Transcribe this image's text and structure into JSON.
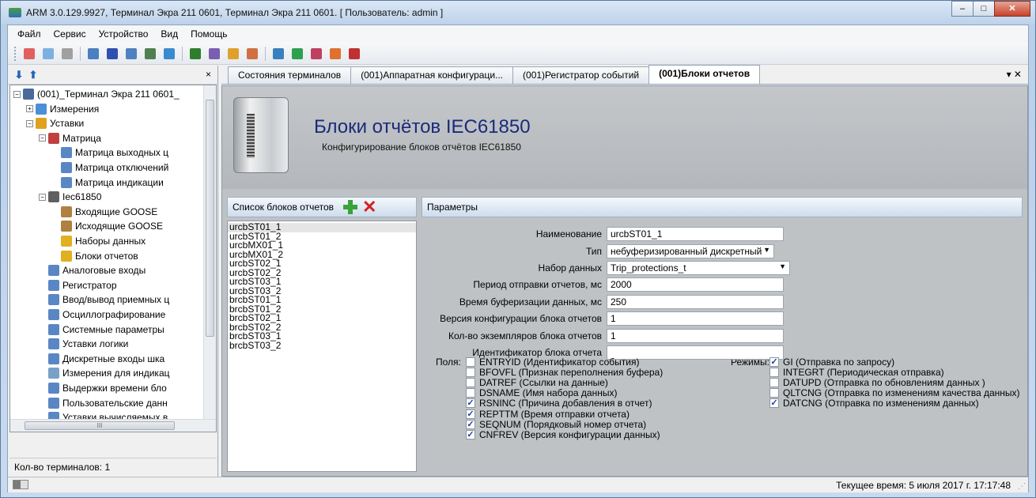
{
  "window": {
    "title": "ARM 3.0.129.9927, Терминал Экра 211 0601, Терминал Экра 211 0601. [ Пользователь: admin ]",
    "buttons": [
      "–",
      "□",
      "✕"
    ]
  },
  "menu": [
    "Файл",
    "Сервис",
    "Устройство",
    "Вид",
    "Помощь"
  ],
  "toolbar": {
    "icons": [
      "#e06060",
      "#7db0e0",
      "#a0a0a0",
      "#4a7fc0",
      "#3050b0",
      "#5080c0",
      "#508050",
      "#3a8ad0",
      "#2f7d2f",
      "#7a5fb0",
      "#e0a030",
      "#d07040",
      "#3a80c0",
      "#30a050",
      "#c04060",
      "#e07030",
      "#c03030"
    ]
  },
  "left_panel": {
    "close": "×",
    "tree": [
      {
        "label": "(001)_Терминал Экра 211 0601_",
        "level": 0,
        "exp": "−",
        "color": "#4a6b9a"
      },
      {
        "label": "Измерения",
        "level": 1,
        "exp": "+",
        "color": "#4b8fd6"
      },
      {
        "label": "Уставки",
        "level": 1,
        "exp": "−",
        "color": "#e0a020"
      },
      {
        "label": "Матрица",
        "level": 2,
        "exp": "−",
        "color": "#c04040"
      },
      {
        "label": "Матрица выходных ц",
        "level": 3,
        "exp": "",
        "color": "#5a87c4"
      },
      {
        "label": "Матрица отключений",
        "level": 3,
        "exp": "",
        "color": "#5a87c4"
      },
      {
        "label": "Матрица индикации",
        "level": 3,
        "exp": "",
        "color": "#5a87c4"
      },
      {
        "label": "Iec61850",
        "level": 2,
        "exp": "−",
        "color": "#606060"
      },
      {
        "label": "Входящие GOOSE",
        "level": 3,
        "exp": "",
        "color": "#b08040"
      },
      {
        "label": "Исходящие GOOSE",
        "level": 3,
        "exp": "",
        "color": "#b08040"
      },
      {
        "label": "Наборы данных",
        "level": 3,
        "exp": "",
        "color": "#e0b020"
      },
      {
        "label": "Блоки отчетов",
        "level": 3,
        "exp": "",
        "color": "#e0b020"
      },
      {
        "label": "Аналоговые входы",
        "level": 2,
        "exp": "",
        "color": "#5a87c4"
      },
      {
        "label": "Регистратор",
        "level": 2,
        "exp": "",
        "color": "#5a87c4"
      },
      {
        "label": "Ввод/вывод приемных ц",
        "level": 2,
        "exp": "",
        "color": "#5a87c4"
      },
      {
        "label": "Осциллографирование",
        "level": 2,
        "exp": "",
        "color": "#5a87c4"
      },
      {
        "label": "Системные параметры",
        "level": 2,
        "exp": "",
        "color": "#5a87c4"
      },
      {
        "label": "Уставки логики",
        "level": 2,
        "exp": "",
        "color": "#5a87c4"
      },
      {
        "label": "Дискретные входы шка",
        "level": 2,
        "exp": "",
        "color": "#5a87c4"
      },
      {
        "label": "Измерения для индикац",
        "level": 2,
        "exp": "",
        "color": "#7aa0c8"
      },
      {
        "label": "Выдержки времени бло",
        "level": 2,
        "exp": "",
        "color": "#5a87c4"
      },
      {
        "label": "Пользовательские данн",
        "level": 2,
        "exp": "",
        "color": "#5a87c4"
      },
      {
        "label": "Уставки вычисляемых в",
        "level": 2,
        "exp": "",
        "color": "#5a87c4"
      }
    ],
    "hscroll_mark": "III",
    "footer": "Кол-во терминалов: 1"
  },
  "tabs": [
    {
      "label": "Состояния терминалов",
      "active": false
    },
    {
      "label": "(001)Аппаратная конфигураци...",
      "active": false
    },
    {
      "label": "(001)Регистратор событий",
      "active": false
    },
    {
      "label": "(001)Блоки отчетов",
      "active": true
    }
  ],
  "tab_controls": "▾ ✕",
  "page": {
    "title": "Блоки отчётов IEC61850",
    "subtitle": "Конфигурирование блоков отчётов IEC61850"
  },
  "report_list": {
    "header": "Список блоков отчетов",
    "items": [
      "urcbST01_1",
      "urcbST01_2",
      "urcbMX01_1",
      "urcbMX01_2",
      "urcbST02_1",
      "urcbST02_2",
      "urcbST03_1",
      "urcbST03_2",
      "brcbST01_1",
      "brcbST01_2",
      "brcbST02_1",
      "brcbST02_2",
      "brcbST03_1",
      "brcbST03_2"
    ],
    "selected_index": 0
  },
  "params": {
    "header": "Параметры",
    "fields": [
      {
        "label": "Наименование",
        "value": "urcbST01_1",
        "kind": "text"
      },
      {
        "label": "Тип",
        "value": "небуферизированный дискретный",
        "kind": "select"
      },
      {
        "label": "Набор данных",
        "value": "Trip_protections_t",
        "kind": "select"
      },
      {
        "label": "Период отправки отчетов, мс",
        "value": "2000",
        "kind": "text"
      },
      {
        "label": "Время буферизации данных, мс",
        "value": "250",
        "kind": "text"
      },
      {
        "label": "Версия конфигурации блока отчетов",
        "value": "1",
        "kind": "text"
      },
      {
        "label": "Кол-во экземпляров блока отчетов",
        "value": "1",
        "kind": "text"
      },
      {
        "label": "Идентификатор блока отчета",
        "value": "",
        "kind": "text"
      }
    ],
    "fields_title": "Поля:",
    "field_options": [
      {
        "label": "ENTRYID (Идентификатор события)",
        "checked": false
      },
      {
        "label": "BFOVFL (Признак переполнения буфера)",
        "checked": false
      },
      {
        "label": "DATREF (Ссылки на данные)",
        "checked": false
      },
      {
        "label": "DSNAME (Имя набора данных)",
        "checked": false
      },
      {
        "label": "RSNINC (Причина добавления в отчет)",
        "checked": true
      },
      {
        "label": "REPTTM (Время отправки отчета)",
        "checked": true
      },
      {
        "label": "SEQNUM (Порядковый номер отчета)",
        "checked": true
      },
      {
        "label": "CNFREV (Версия конфигурации данных)",
        "checked": true
      }
    ],
    "modes_title": "Режимы:",
    "mode_options": [
      {
        "label": "GI (Отправка по запросу)",
        "checked": true
      },
      {
        "label": "INTEGRT (Периодическая отправка)",
        "checked": false
      },
      {
        "label": "DATUPD (Отправка по обновлениям данных )",
        "checked": false
      },
      {
        "label": "QLTCNG (Отправка по изменениям качества данных)",
        "checked": false
      },
      {
        "label": "DATCNG (Отправка по изменениям данных)",
        "checked": true
      }
    ]
  },
  "status": {
    "time": "Текущее время: 5 июля 2017 г. 17:17:48"
  }
}
